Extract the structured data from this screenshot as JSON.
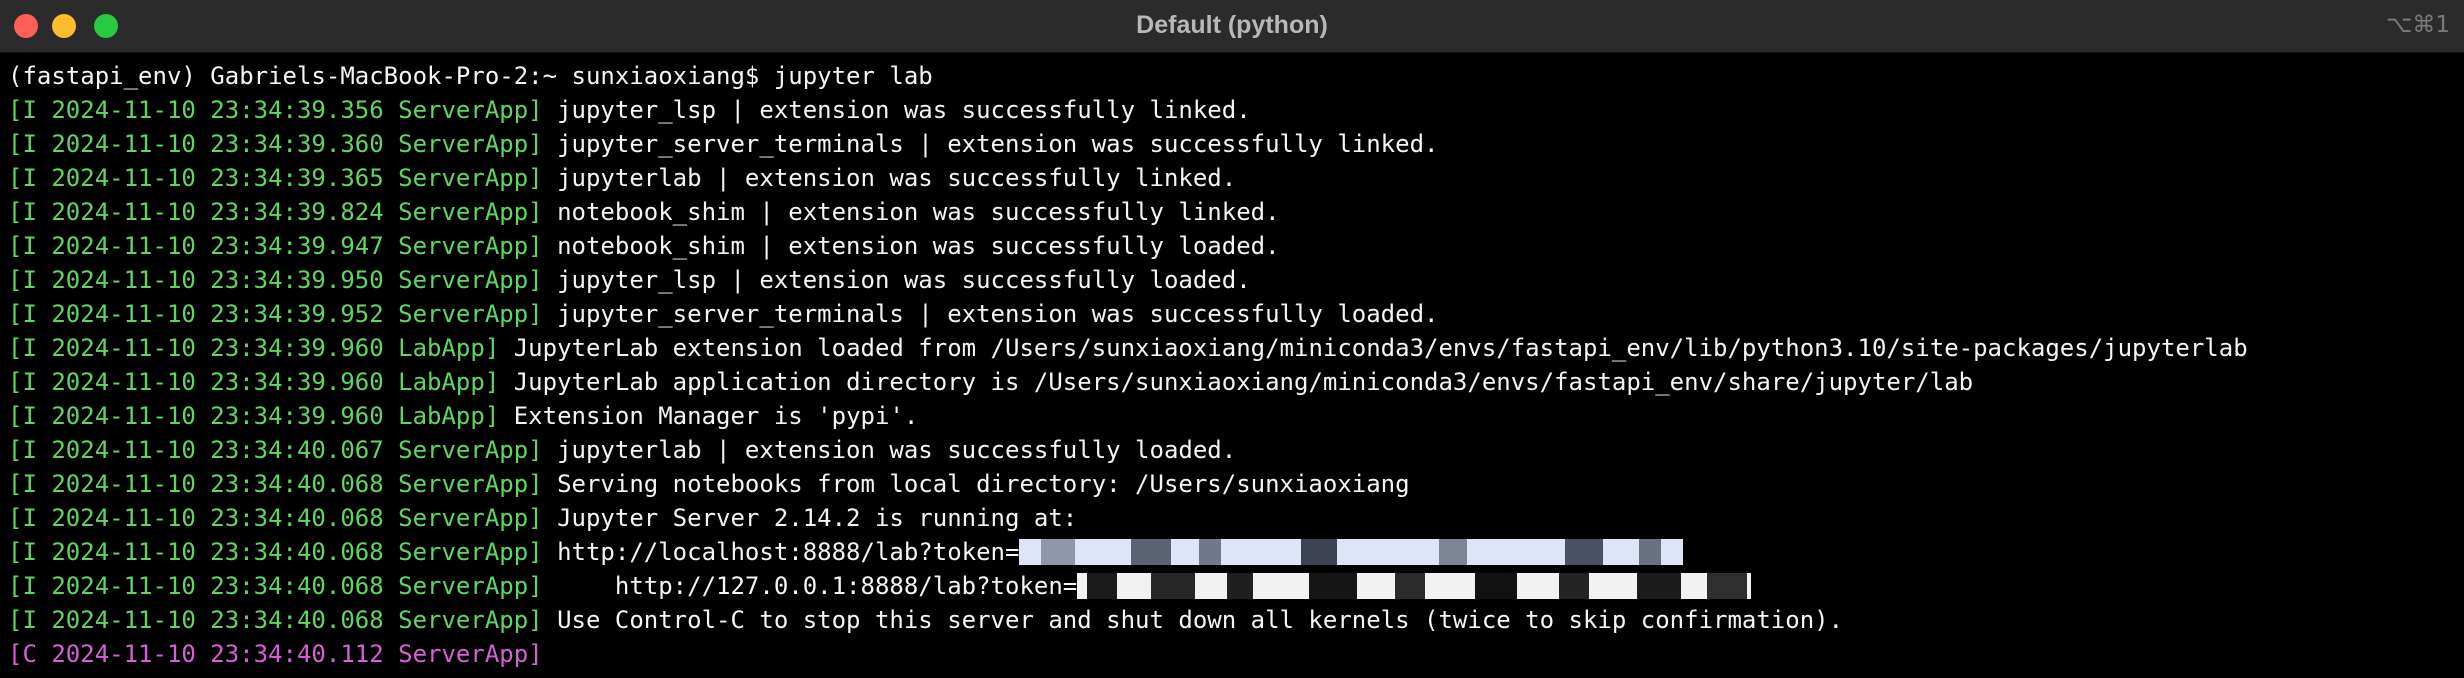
{
  "window": {
    "title": "Default (python)",
    "shortcut": "⌥⌘1"
  },
  "icons": {
    "close": "close-icon",
    "minimize": "minimize-icon",
    "zoom": "zoom-icon"
  },
  "colors": {
    "background": "#000000",
    "info_tag": "#5fd75f",
    "critical_tag": "#d75fd7",
    "text": "#f5f5f5",
    "close": "#ff5f57",
    "minimize": "#febc2e",
    "zoom": "#28c840"
  },
  "terminal": {
    "prompt": "(fastapi_env) Gabriels-MacBook-Pro-2:~ sunxiaoxiang$ jupyter lab",
    "lines": [
      {
        "tag": "[I 2024-11-10 23:34:39.356 ServerApp]",
        "msg": " jupyter_lsp | extension was successfully linked."
      },
      {
        "tag": "[I 2024-11-10 23:34:39.360 ServerApp]",
        "msg": " jupyter_server_terminals | extension was successfully linked."
      },
      {
        "tag": "[I 2024-11-10 23:34:39.365 ServerApp]",
        "msg": " jupyterlab | extension was successfully linked."
      },
      {
        "tag": "[I 2024-11-10 23:34:39.824 ServerApp]",
        "msg": " notebook_shim | extension was successfully linked."
      },
      {
        "tag": "[I 2024-11-10 23:34:39.947 ServerApp]",
        "msg": " notebook_shim | extension was successfully loaded."
      },
      {
        "tag": "[I 2024-11-10 23:34:39.950 ServerApp]",
        "msg": " jupyter_lsp | extension was successfully loaded."
      },
      {
        "tag": "[I 2024-11-10 23:34:39.952 ServerApp]",
        "msg": " jupyter_server_terminals | extension was successfully loaded."
      },
      {
        "tag": "[I 2024-11-10 23:34:39.960 LabApp]",
        "msg": " JupyterLab extension loaded from /Users/sunxiaoxiang/miniconda3/envs/fastapi_env/lib/python3.10/site-packages/jupyterlab"
      },
      {
        "tag": "[I 2024-11-10 23:34:39.960 LabApp]",
        "msg": " JupyterLab application directory is /Users/sunxiaoxiang/miniconda3/envs/fastapi_env/share/jupyter/lab"
      },
      {
        "tag": "[I 2024-11-10 23:34:39.960 LabApp]",
        "msg": " Extension Manager is 'pypi'."
      },
      {
        "tag": "[I 2024-11-10 23:34:40.067 ServerApp]",
        "msg": " jupyterlab | extension was successfully loaded."
      },
      {
        "tag": "[I 2024-11-10 23:34:40.068 ServerApp]",
        "msg": " Serving notebooks from local directory: /Users/sunxiaoxiang"
      },
      {
        "tag": "[I 2024-11-10 23:34:40.068 ServerApp]",
        "msg": " Jupyter Server 2.14.2 is running at:"
      },
      {
        "tag": "[I 2024-11-10 23:34:40.068 ServerApp]",
        "msg": " http://localhost:8888/lab?token="
      },
      {
        "tag": "[I 2024-11-10 23:34:40.068 ServerApp]",
        "msg": "     http://127.0.0.1:8888/lab?token="
      },
      {
        "tag": "[I 2024-11-10 23:34:40.068 ServerApp]",
        "msg": " Use Control-C to stop this server and shut down all kernels (twice to skip confirmation)."
      },
      {
        "tag": "[C 2024-11-10 23:34:40.112 ServerApp]",
        "msg": ""
      }
    ]
  }
}
